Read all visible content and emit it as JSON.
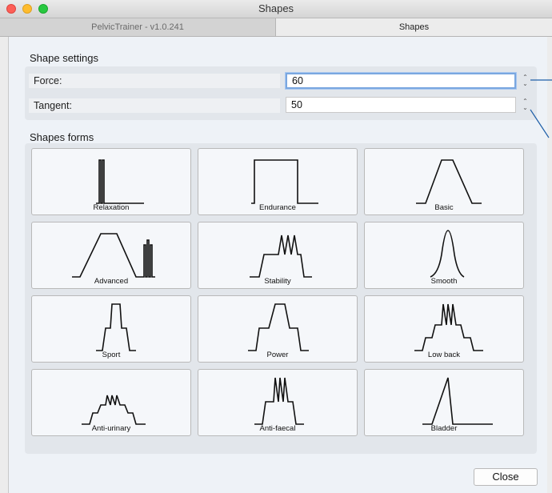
{
  "window": {
    "title": "Shapes"
  },
  "tabs": [
    {
      "label": "PelvicTrainer - v1.0.241",
      "active": false
    },
    {
      "label": "Shapes",
      "active": true
    }
  ],
  "settings": {
    "heading": "Shape settings",
    "force": {
      "label": "Force:",
      "value": "60"
    },
    "tangent": {
      "label": "Tangent:",
      "value": "50"
    }
  },
  "forms": {
    "heading": "Shapes forms",
    "items": [
      {
        "label": "Relaxation",
        "shape": "relaxation"
      },
      {
        "label": "Endurance",
        "shape": "endurance"
      },
      {
        "label": "Basic",
        "shape": "basic"
      },
      {
        "label": "Advanced",
        "shape": "advanced"
      },
      {
        "label": "Stability",
        "shape": "stability"
      },
      {
        "label": "Smooth",
        "shape": "smooth"
      },
      {
        "label": "Sport",
        "shape": "sport"
      },
      {
        "label": "Power",
        "shape": "power"
      },
      {
        "label": "Low back",
        "shape": "low-back"
      },
      {
        "label": "Anti-urinary",
        "shape": "anti-urinary"
      },
      {
        "label": "Anti-faecal",
        "shape": "anti-faecal"
      },
      {
        "label": "Bladder",
        "shape": "bladder"
      }
    ]
  },
  "footer": {
    "close_label": "Close"
  },
  "colors": {
    "focus_ring": "#7aa7e0",
    "connector_line": "#1f5fa8",
    "panel_bg": "#eef2f7"
  }
}
